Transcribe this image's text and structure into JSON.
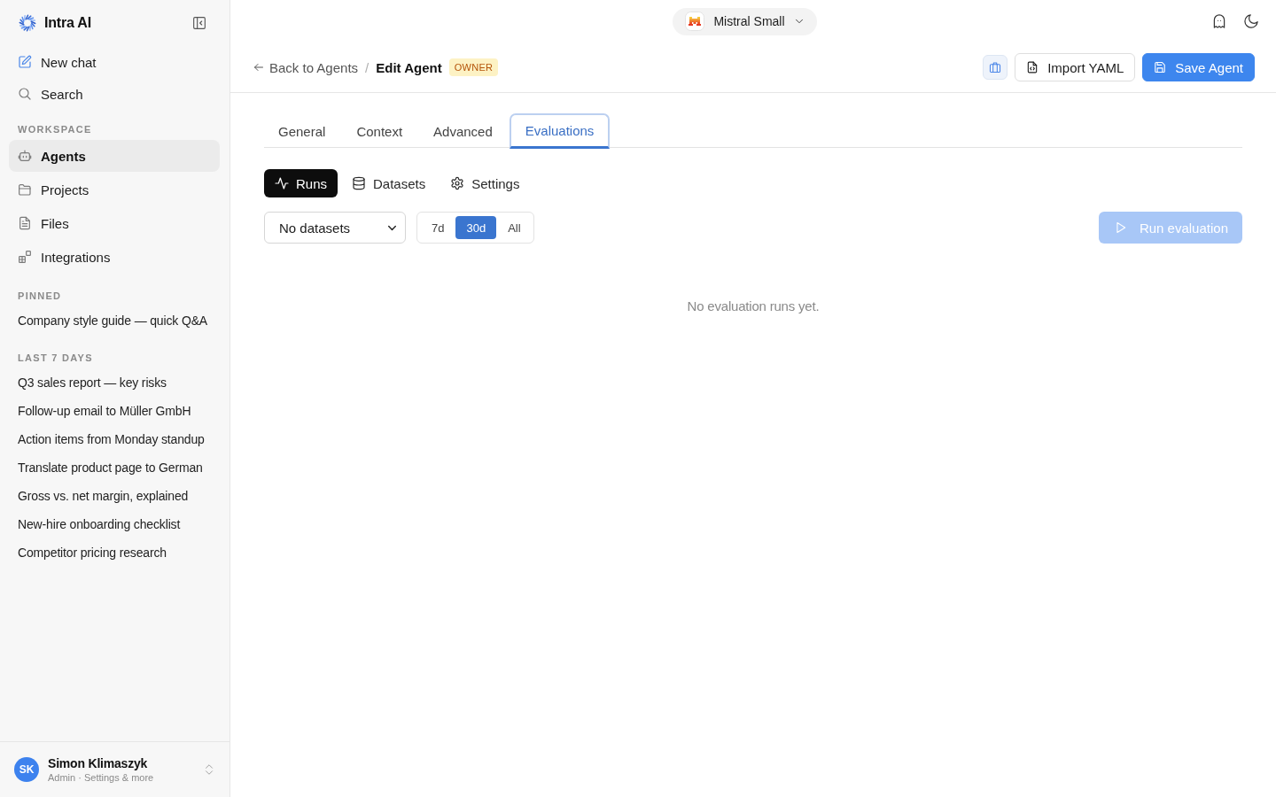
{
  "sidebar": {
    "brand": "Intra AI",
    "actions": [
      {
        "label": "New chat"
      },
      {
        "label": "Search"
      }
    ],
    "sections": [
      {
        "heading": "WORKSPACE",
        "kind": "nav",
        "items": [
          {
            "label": "Agents",
            "selected": true
          },
          {
            "label": "Projects",
            "selected": false
          },
          {
            "label": "Files",
            "selected": false
          },
          {
            "label": "Integrations",
            "selected": false
          }
        ]
      },
      {
        "heading": "PINNED",
        "kind": "history",
        "items": [
          {
            "label": "Company style guide — quick Q&A"
          }
        ]
      },
      {
        "heading": "LAST 7 DAYS",
        "kind": "history",
        "items": [
          {
            "label": "Q3 sales report — key risks"
          },
          {
            "label": "Follow-up email to Müller GmbH"
          },
          {
            "label": "Action items from Monday standup"
          },
          {
            "label": "Translate product page to German"
          },
          {
            "label": "Gross vs. net margin, explained"
          },
          {
            "label": "New-hire onboarding checklist"
          },
          {
            "label": "Competitor pricing research"
          }
        ]
      }
    ],
    "user": {
      "initials": "SK",
      "name": "Simon Klimaszyk",
      "subtitle": "Admin · Settings & more"
    }
  },
  "topbar": {
    "model": "Mistral Small"
  },
  "header": {
    "back": "Back to Agents",
    "separator": "/",
    "title": "Edit Agent",
    "badge": "OWNER",
    "buttons": [
      {
        "kind": "icon"
      },
      {
        "kind": "outline",
        "label": "Import YAML"
      },
      {
        "kind": "primary",
        "label": "Save Agent"
      }
    ]
  },
  "tabs": [
    {
      "label": "General",
      "selected": false
    },
    {
      "label": "Context",
      "selected": false
    },
    {
      "label": "Advanced",
      "selected": false
    },
    {
      "label": "Evaluations",
      "selected": true
    }
  ],
  "subtabs": [
    {
      "label": "Runs",
      "selected": true
    },
    {
      "label": "Datasets",
      "selected": false
    },
    {
      "label": "Settings",
      "selected": false
    }
  ],
  "toolbar": {
    "dataset_select": "No datasets",
    "ranges": [
      {
        "label": "7d",
        "selected": false
      },
      {
        "label": "30d",
        "selected": true
      },
      {
        "label": "All",
        "selected": false
      }
    ],
    "run_button": {
      "label": "Run evaluation",
      "disabled": true
    }
  },
  "empty_state": "No evaluation runs yet."
}
